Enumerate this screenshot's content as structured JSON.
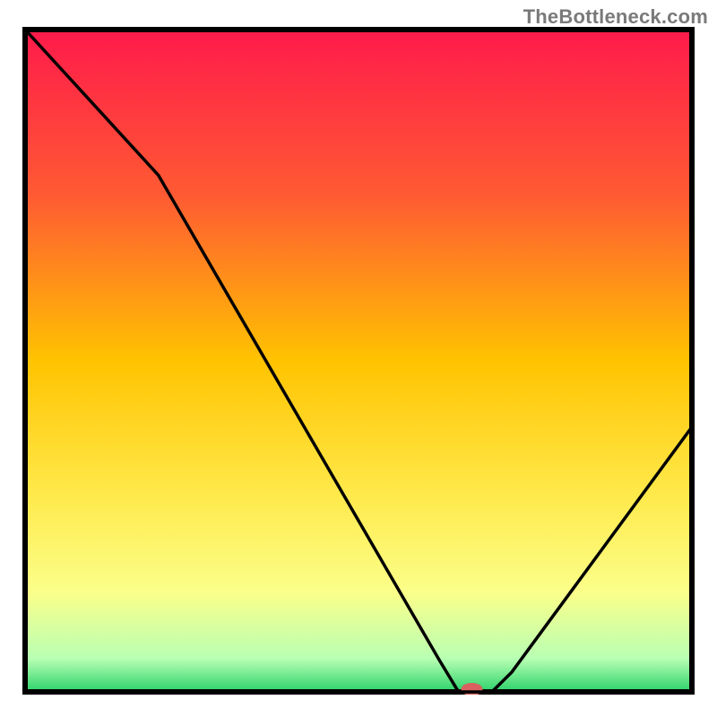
{
  "watermark": "TheBottleneck.com",
  "chart_data": {
    "type": "line",
    "title": "",
    "xlabel": "",
    "ylabel": "",
    "ylim": [
      0,
      100
    ],
    "xlim": [
      0,
      100
    ],
    "x": [
      0,
      20,
      62,
      65,
      70,
      73,
      100
    ],
    "values": [
      100,
      78,
      5,
      0,
      0,
      3,
      40
    ],
    "gradient_stops": [
      {
        "offset": 0,
        "color": "#ff1a4b"
      },
      {
        "offset": 0.25,
        "color": "#ff5a33"
      },
      {
        "offset": 0.5,
        "color": "#ffc300"
      },
      {
        "offset": 0.7,
        "color": "#ffe94a"
      },
      {
        "offset": 0.85,
        "color": "#fbff8a"
      },
      {
        "offset": 0.95,
        "color": "#b8ffb3"
      },
      {
        "offset": 1.0,
        "color": "#2bd36a"
      }
    ],
    "marker": {
      "x": 67,
      "y": 0,
      "color": "#d9605f",
      "rx": 12,
      "ry": 7
    },
    "frame_color": "#000000",
    "line_color": "#000000"
  }
}
